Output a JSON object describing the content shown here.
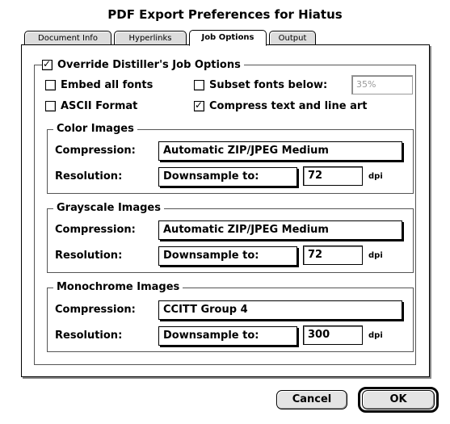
{
  "window": {
    "title": "PDF Export Preferences for Hiatus"
  },
  "tabs": [
    {
      "label": "Document Info"
    },
    {
      "label": "Hyperlinks"
    },
    {
      "label": "Job Options"
    },
    {
      "label": "Output"
    }
  ],
  "override": {
    "label": "Override Distiller's Job Options",
    "checked": true
  },
  "options": {
    "embed_fonts": {
      "label": "Embed all fonts",
      "checked": false
    },
    "subset_fonts": {
      "label": "Subset fonts below:",
      "checked": false,
      "value": "35%"
    },
    "ascii": {
      "label": "ASCII Format",
      "checked": false
    },
    "compress_text": {
      "label": "Compress text and line art",
      "checked": true
    }
  },
  "labels": {
    "compression": "Compression:",
    "resolution": "Resolution:",
    "dpi": "dpi"
  },
  "color": {
    "title": "Color Images",
    "compression": "Automatic ZIP/JPEG Medium",
    "resolution_mode": "Downsample to:",
    "resolution": "72"
  },
  "grayscale": {
    "title": "Grayscale Images",
    "compression": "Automatic ZIP/JPEG Medium",
    "resolution_mode": "Downsample to:",
    "resolution": "72"
  },
  "mono": {
    "title": "Monochrome Images",
    "compression": "CCITT Group 4",
    "resolution_mode": "Downsample to:",
    "resolution": "300"
  },
  "buttons": {
    "cancel": "Cancel",
    "ok": "OK"
  }
}
